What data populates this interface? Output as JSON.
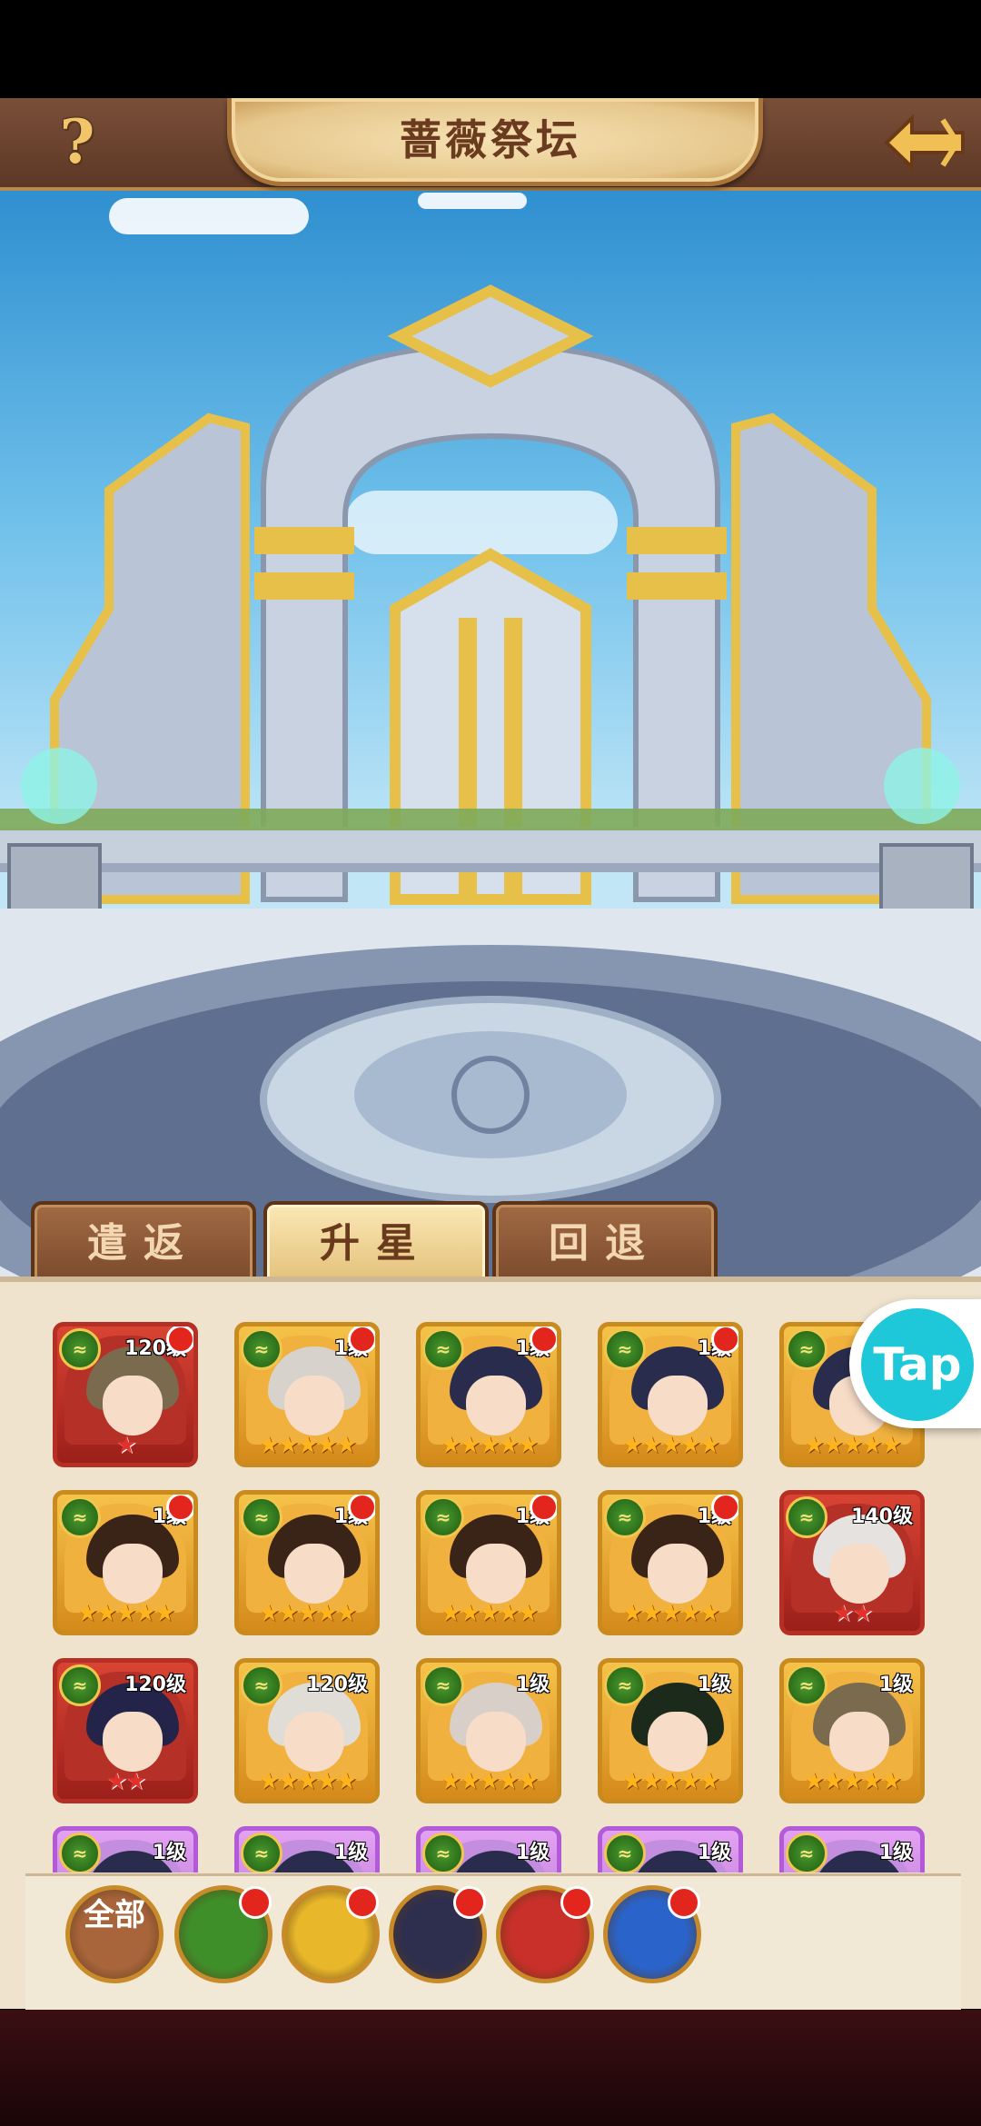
{
  "header": {
    "help_label": "?",
    "title": "蔷薇祭坛"
  },
  "tabs": [
    {
      "label": "遣返",
      "active": false
    },
    {
      "label": "升星",
      "active": true
    },
    {
      "label": "回退",
      "active": false
    }
  ],
  "heroes": [
    {
      "level": "120级",
      "stars": "★",
      "star_type": "red",
      "frame": "red",
      "hair": "#7a6a4e",
      "badge": true
    },
    {
      "level": "1级",
      "stars": "★★★★★",
      "star_type": "gold",
      "frame": "gold",
      "hair": "#d8d2cc",
      "badge": true
    },
    {
      "level": "1级",
      "stars": "★★★★★",
      "star_type": "gold",
      "frame": "gold",
      "hair": "#2a2c4e",
      "badge": true
    },
    {
      "level": "1级",
      "stars": "★★★★★",
      "star_type": "gold",
      "frame": "gold",
      "hair": "#2a2c4e",
      "badge": true
    },
    {
      "level": "",
      "stars": "★★★★★",
      "star_type": "gold",
      "frame": "gold",
      "hair": "#2a2c4e",
      "badge": true
    },
    {
      "level": "1级",
      "stars": "★★★★★",
      "star_type": "gold",
      "frame": "gold",
      "hair": "#3a2418",
      "badge": true
    },
    {
      "level": "1级",
      "stars": "★★★★★",
      "star_type": "gold",
      "frame": "gold",
      "hair": "#3a2418",
      "badge": true
    },
    {
      "level": "1级",
      "stars": "★★★★★",
      "star_type": "gold",
      "frame": "gold",
      "hair": "#3a2418",
      "badge": true
    },
    {
      "level": "1级",
      "stars": "★★★★★",
      "star_type": "gold",
      "frame": "gold",
      "hair": "#3a2418",
      "badge": true
    },
    {
      "level": "140级",
      "stars": "★★",
      "star_type": "red",
      "frame": "red",
      "hair": "#e6e2e0",
      "badge": false
    },
    {
      "level": "120级",
      "stars": "★★",
      "star_type": "red",
      "frame": "red",
      "hair": "#24244a",
      "badge": false
    },
    {
      "level": "120级",
      "stars": "★★★★★",
      "star_type": "gold",
      "frame": "gold",
      "hair": "#e0dcd6",
      "badge": false
    },
    {
      "level": "1级",
      "stars": "★★★★★",
      "star_type": "gold",
      "frame": "gold",
      "hair": "#d8d0c8",
      "badge": false
    },
    {
      "level": "1级",
      "stars": "★★★★★",
      "star_type": "gold",
      "frame": "gold",
      "hair": "#1c2a1c",
      "badge": false
    },
    {
      "level": "1级",
      "stars": "★★★★★",
      "star_type": "gold",
      "frame": "gold",
      "hair": "#7a6a4e",
      "badge": false
    },
    {
      "level": "1级",
      "stars": "",
      "star_type": "gold",
      "frame": "purple",
      "hair": "#2a2c4e",
      "badge": false
    },
    {
      "level": "1级",
      "stars": "",
      "star_type": "gold",
      "frame": "purple",
      "hair": "#2a2c4e",
      "badge": false
    },
    {
      "level": "1级",
      "stars": "",
      "star_type": "gold",
      "frame": "purple",
      "hair": "#2a2c4e",
      "badge": false
    },
    {
      "level": "1级",
      "stars": "",
      "star_type": "gold",
      "frame": "purple",
      "hair": "#2a2c4e",
      "badge": false
    },
    {
      "level": "1级",
      "stars": "",
      "star_type": "gold",
      "frame": "purple",
      "hair": "#2a2c4e",
      "badge": false
    }
  ],
  "filters": [
    {
      "name": "filter-all-button",
      "label": "全部",
      "color": "#a8643a",
      "badge": false
    },
    {
      "name": "filter-nature-button",
      "label": "",
      "color": "#3e8f2a",
      "badge": true
    },
    {
      "name": "filter-rose-button",
      "label": "",
      "color": "#e9b72a",
      "badge": true
    },
    {
      "name": "filter-dark-button",
      "label": "",
      "color": "#2e2f4e",
      "badge": true
    },
    {
      "name": "filter-fire-button",
      "label": "",
      "color": "#c9302a",
      "badge": true
    },
    {
      "name": "filter-water-button",
      "label": "",
      "color": "#2a63c9",
      "badge": true
    }
  ],
  "floating": {
    "tap_label": "Tap"
  },
  "colors": {
    "accent": "#c98b2a",
    "brown": "#7a4f38"
  }
}
